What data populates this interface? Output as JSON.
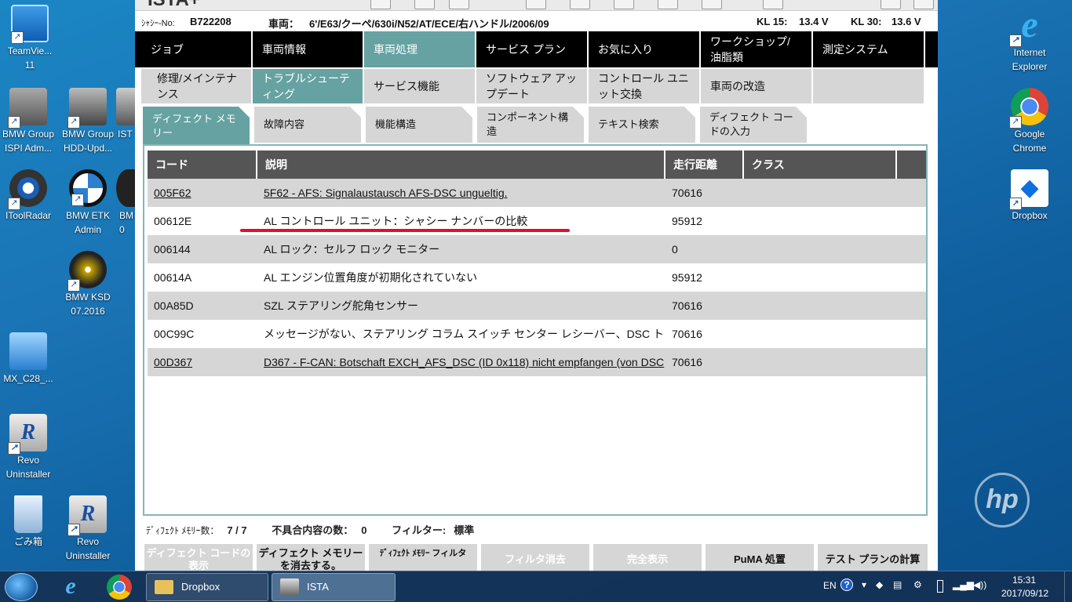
{
  "desktop": {
    "icons": [
      {
        "label": "TeamVie...\n11"
      },
      {
        "label": "BMW Group\nISPI Adm..."
      },
      {
        "label": "BMW Group\nHDD-Upd..."
      },
      {
        "label": "IST"
      },
      {
        "label": "IToolRadar"
      },
      {
        "label": "BMW ETK\nAdmin"
      },
      {
        "label": "BM\n0"
      },
      {
        "label": "BMW KSD\n07.2016"
      },
      {
        "label": "MX_C28_..."
      },
      {
        "label": "Revo\nUninstaller"
      },
      {
        "label": "ごみ箱"
      },
      {
        "label": "Revo\nUninstaller"
      },
      {
        "label": "Internet\nExplorer"
      },
      {
        "label": "Google\nChrome"
      },
      {
        "label": "Dropbox"
      }
    ],
    "hp_logo": "hp"
  },
  "ista": {
    "brand": "ISTA+",
    "vin_label": "ｼｬｼｰ-No:",
    "vin": "B722208",
    "vehicle_label": "車両：",
    "vehicle": "6'/E63/クーペ/630i/N52/AT/ECE/右ハンドル/2006/09",
    "kl15_label": "KL 15:",
    "kl15": "13.4 V",
    "kl30_label": "KL 30:",
    "kl30": "13.6 V",
    "nav": [
      "ジョブ",
      "車両情報",
      "車両処理",
      "サービス プラン",
      "お気に入り",
      "ワークショップ/ 油脂類",
      "測定システム"
    ],
    "subnav": [
      "修理/メインテナンス",
      "トラブルシューティング",
      "サービス機能",
      "ソフトウェア アップデート",
      "コントロール ユニット交換",
      "車両の改造",
      ""
    ],
    "tabs": [
      "ディフェクト メモリー",
      "故障内容",
      "機能構造",
      "コンポーネント構造",
      "テキスト検索",
      "ディフェクト コードの入力"
    ],
    "table": {
      "headers": [
        "コード",
        "説明",
        "走行距離",
        "クラス"
      ],
      "rows": [
        {
          "code": "005F62",
          "desc": "5F62 - AFS: Signalaustausch AFS-DSC ungueltig.",
          "mileage": "70616",
          "class": "",
          "link": true
        },
        {
          "code": "00612E",
          "desc": "AL コントロール ユニット：シャシー ナンバーの比較",
          "mileage": "95912",
          "class": "",
          "link": false
        },
        {
          "code": "006144",
          "desc": "AL ロック：セルフ ロック モニター",
          "mileage": "0",
          "class": "",
          "link": false
        },
        {
          "code": "00614A",
          "desc": "AL エンジン位置角度が初期化されていない",
          "mileage": "95912",
          "class": "",
          "link": false
        },
        {
          "code": "00A85D",
          "desc": "SZL ステアリング舵角センサー",
          "mileage": "70616",
          "class": "",
          "link": false
        },
        {
          "code": "00C99C",
          "desc": "メッセージがない、ステアリング コラム スイッチ センター レシーバー、DSC ト",
          "mileage": "70616",
          "class": "",
          "link": false
        },
        {
          "code": "00D367",
          "desc": "D367 - F-CAN: Botschaft EXCH_AFS_DSC (ID 0x118) nicht empfangen (von DSC",
          "mileage": "70616",
          "class": "",
          "link": true
        }
      ]
    },
    "status": {
      "defect_count_label": "ﾃﾞｨﾌｪｸﾄ ﾒﾓﾘｰ数：",
      "defect_count": "7 / 7",
      "fault_count_label": "不具合内容の数：",
      "fault_count": "0",
      "filter_label": "フィルター:",
      "filter": "標準"
    },
    "buttons": [
      "ディフェクト コードの表示",
      "ディフェクト メモリーを消去する。",
      "ﾃﾞｨﾌｪｸﾄ ﾒﾓﾘｰ フィルタ",
      "フィルタ消去",
      "完全表示",
      "PuMA 処置",
      "テスト プランの計算"
    ]
  },
  "taskbar": {
    "tasks": [
      "Dropbox",
      "ISTA"
    ],
    "lang": "EN",
    "time": "15:31",
    "date": "2017/09/12"
  }
}
